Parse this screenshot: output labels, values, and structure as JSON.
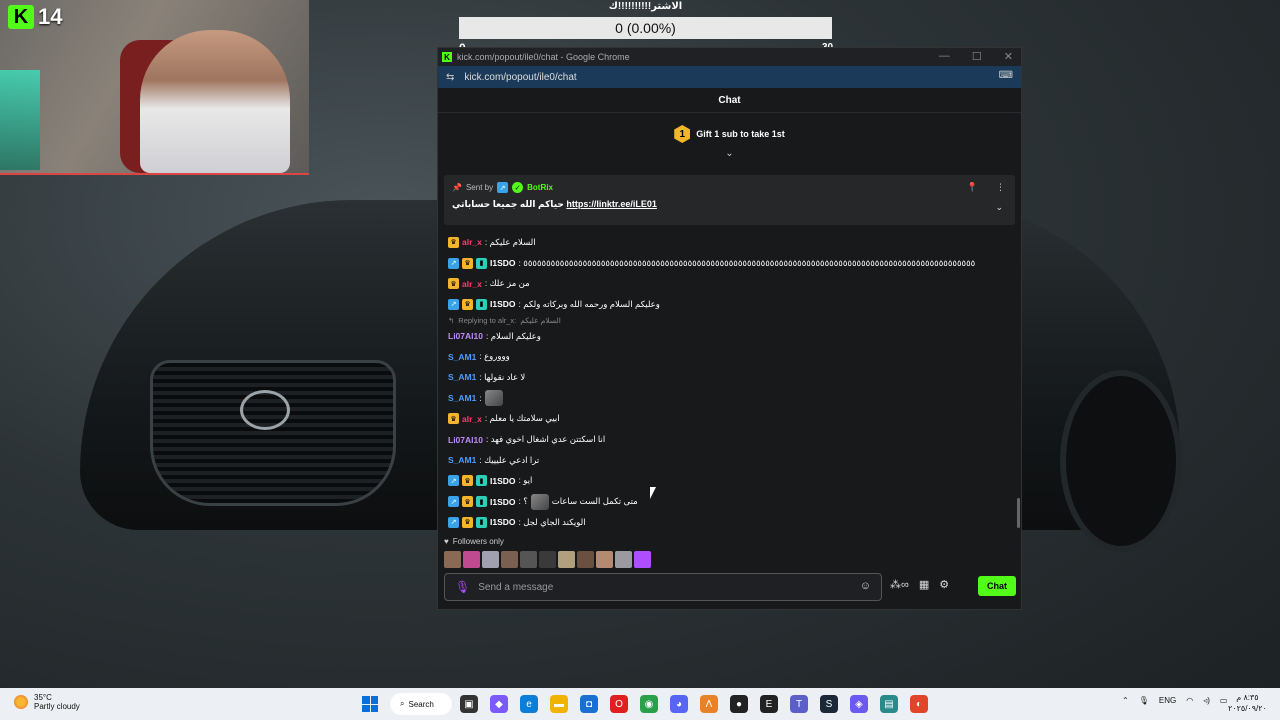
{
  "stream": {
    "kick_count": "14"
  },
  "goal": {
    "title": "الاشتر!!!!!!!!!!ك",
    "progress_text": "0 (0.00%)",
    "min": "0",
    "max": "30",
    "progress": 0
  },
  "window": {
    "title": "kick.com/popout/ile0/chat - Google Chrome",
    "url": "kick.com/popout/ile0/chat",
    "chat_header": "Chat",
    "gift_text": "Gift 1 sub to take 1st",
    "gift_rank": "1"
  },
  "pinned": {
    "sent_by": "Sent by",
    "bot_name": "BotRix",
    "message_prefix": "حياكم الله جميعا حساباتي",
    "link": "https://linktr.ee/iLE01"
  },
  "messages": [
    {
      "badges": [
        "gold"
      ],
      "user": "alr_x",
      "color": "#ff3d6e",
      "text": ": السلام عليكم"
    },
    {
      "badges": [
        "blue",
        "gold",
        "teal"
      ],
      "user": "I1SDO",
      "color": "#ffffff",
      "text": ": ٥٥٥٥٥٥٥٥٥٥٥٥٥٥٥٥٥٥٥٥٥٥٥٥٥٥٥٥٥٥٥٥٥٥٥٥٥٥٥٥٥٥٥٥٥٥٥٥٥٥٥٥٥٥٥٥٥٥٥٥٥٥٥٥٥٥٥٥٥٥٥٥٥٥٥٥٥٥٥٥٥٥٥٥٥٥٥٥٥٥٥٥٥٥٥٥٥٥٥"
    },
    {
      "badges": [
        "gold"
      ],
      "user": "alr_x",
      "color": "#ff3d6e",
      "text": ": من مز علك"
    },
    {
      "badges": [
        "blue",
        "gold",
        "teal"
      ],
      "user": "I1SDO",
      "color": "#ffffff",
      "text": ": وعليكم السلام ورحمه الله وبركاته ولكم"
    },
    {
      "reply": "Replying to alr_x:",
      "reply_text": "السلام عليكم",
      "badges": [],
      "user": "Li07Al10",
      "color": "#c08bff",
      "text": ": وعليكم السلام"
    },
    {
      "badges": [],
      "user": "S_AM1",
      "color": "#4c9cff",
      "text": ": وووروع"
    },
    {
      "badges": [],
      "user": "S_AM1",
      "color": "#4c9cff",
      "text": ": لا عاد نقولها"
    },
    {
      "badges": [],
      "user": "S_AM1",
      "color": "#4c9cff",
      "text": ":",
      "emote": true
    },
    {
      "badges": [
        "gold"
      ],
      "user": "alr_x",
      "color": "#ff3d6e",
      "text": ": ابيي سلامتك يا معلم"
    },
    {
      "badges": [],
      "user": "Li07Al10",
      "color": "#c08bff",
      "text": ": انا اسكتتن عدي اشغال اخوي فهد"
    },
    {
      "badges": [],
      "user": "S_AM1",
      "color": "#4c9cff",
      "text": ": ترا ادعي عليييك"
    },
    {
      "badges": [
        "blue",
        "gold",
        "teal"
      ],
      "user": "I1SDO",
      "color": "#ffffff",
      "text": ": ايو"
    },
    {
      "badges": [
        "blue",
        "gold",
        "teal"
      ],
      "user": "I1SDO",
      "color": "#ffffff",
      "text": ": ؟",
      "emote": true,
      "after": "متى تكمل الست ساعات"
    },
    {
      "badges": [
        "blue",
        "gold",
        "teal"
      ],
      "user": "I1SDO",
      "color": "#ffffff",
      "text": ": الويكند الجاي لجل"
    }
  ],
  "followers_label": "Followers only",
  "input": {
    "placeholder": "Send a message",
    "send_label": "Chat"
  },
  "taskbar": {
    "temp": "35°C",
    "weather": "Partly cloudy",
    "search_label": "Search",
    "lang": "ENG",
    "time": "٨:٣٥ م",
    "date": "٢٠٢٥/٠٩/٢٠"
  },
  "colors": {
    "kick_green": "#53fc18",
    "chat_bg": "#18191b",
    "taskbar_bg": "#eceff3"
  }
}
